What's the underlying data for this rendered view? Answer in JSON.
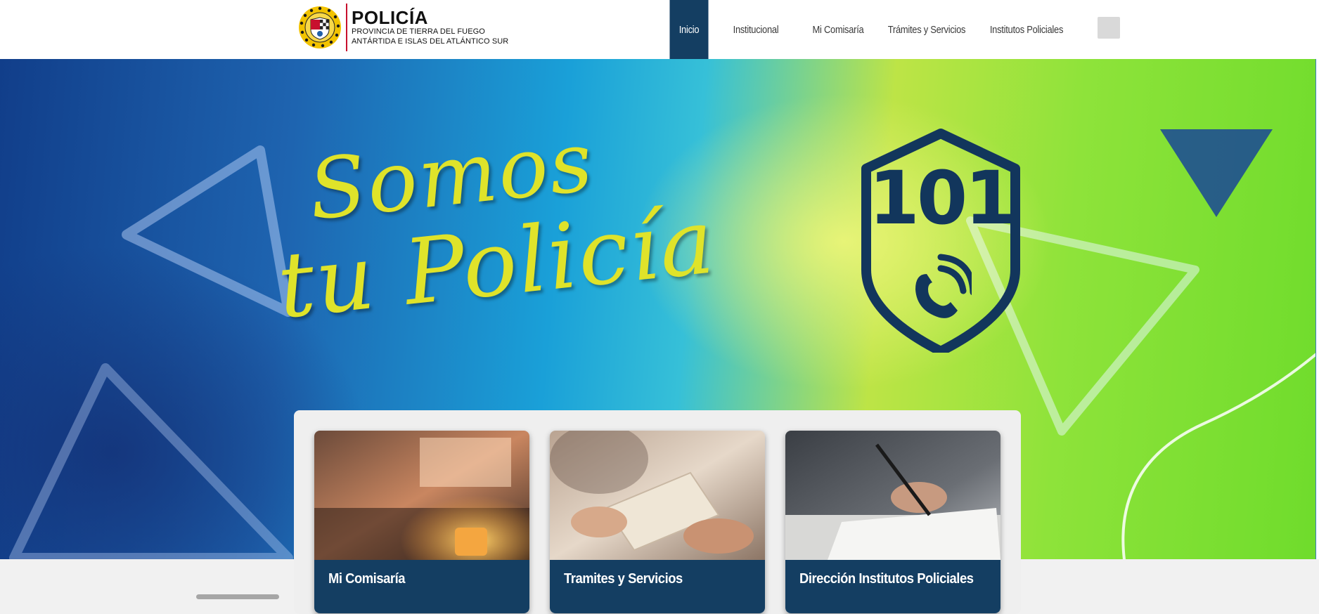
{
  "brand": {
    "title": "POLICÍA",
    "subtitle_line1": "PROVINCIA DE TIERRA DEL FUEGO",
    "subtitle_line2": "ANTÁRTIDA E ISLAS DEL ATLÁNTICO SUR",
    "accent_color": "#c8102e"
  },
  "nav": {
    "items": [
      {
        "label": "Inicio",
        "active": true
      },
      {
        "label": "Institucional",
        "active": false
      },
      {
        "label": "Mi Comisaría",
        "active": false
      },
      {
        "label": "Trámites y Servicios",
        "active": false
      },
      {
        "label": "Institutos Policiales",
        "active": false
      }
    ],
    "search_icon": "search-icon",
    "active_color": "#143e62"
  },
  "hero": {
    "headline_line1": "Somos",
    "headline_line2": "tu Policía",
    "badge_number": "101",
    "badge_icon": "phone-icon",
    "headline_color": "#dfe32a",
    "badge_color": "#12365c"
  },
  "cards": [
    {
      "title": "Mi Comisaría",
      "image": "office-desk-lamp-photo"
    },
    {
      "title": "Tramites y Servicios",
      "image": "document-handover-photo"
    },
    {
      "title": "Dirección Institutos Policiales",
      "image": "student-writing-photo"
    }
  ],
  "colors": {
    "card_footer": "#143e62",
    "page_background": "#f1f1f1"
  }
}
